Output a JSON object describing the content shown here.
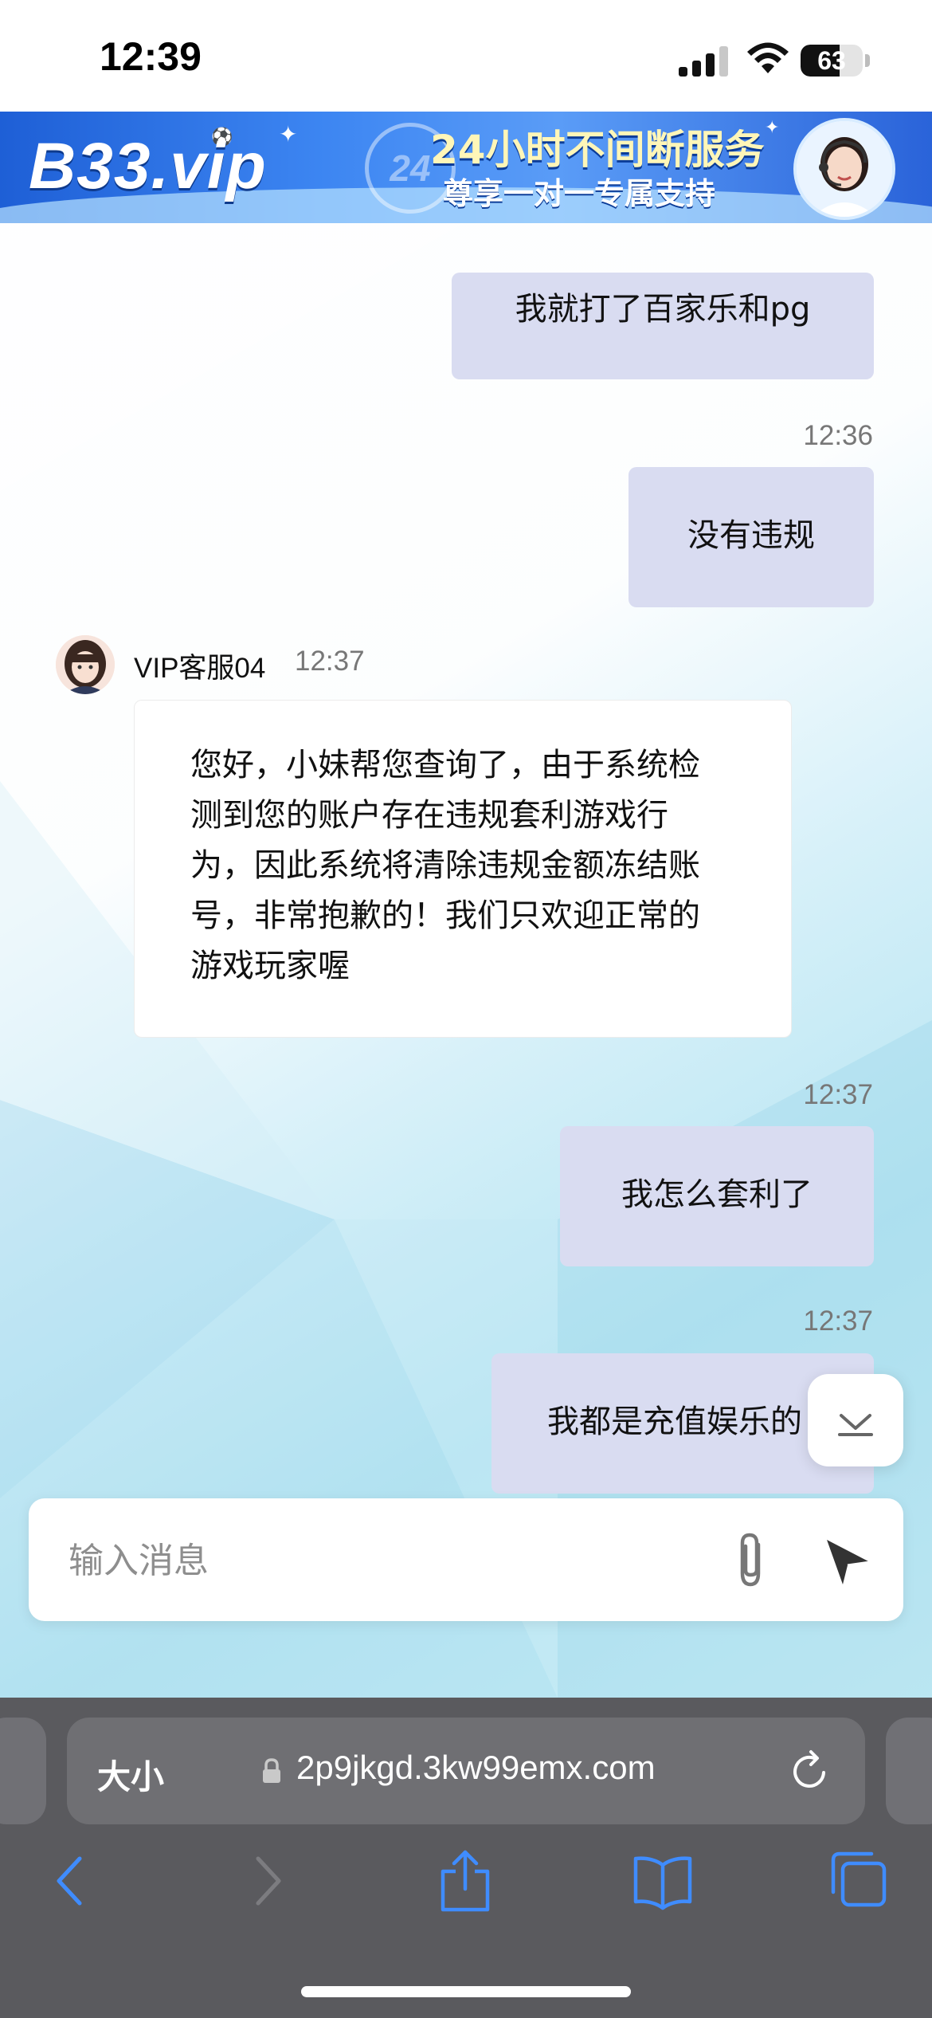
{
  "status_bar": {
    "time": "12:39",
    "battery_level": "63",
    "battery_fraction": 0.63
  },
  "banner": {
    "logo_text": "B33.vip",
    "hours_badge": "24",
    "headline": "24小时不间断服务",
    "subheadline": "尊享一对一专属支持"
  },
  "chat": {
    "messages": [
      {
        "from": "me",
        "text": "我就打了百家乐和pg"
      },
      {
        "from": "me",
        "time": "12:36",
        "text": "没有违规"
      },
      {
        "from": "agent",
        "name": "VIP客服04",
        "time": "12:37",
        "lines": [
          "您好，小妹帮您查询了，由于系统检",
          "测到您的账户存在违规套利游戏行",
          "为，因此系统将清除违规金额冻结账",
          "号，非常抱歉的！我们只欢迎正常的",
          "游戏玩家喔"
        ]
      },
      {
        "from": "me",
        "time": "12:37",
        "text": "我怎么套利了"
      },
      {
        "from": "me",
        "time": "12:37",
        "text": "我都是充值娱乐的"
      }
    ]
  },
  "composer": {
    "placeholder": "输入消息",
    "value": ""
  },
  "browser": {
    "text_size_label": "大小",
    "url": "2p9jkgd.3kw99emx.com"
  },
  "colors": {
    "my_bubble": "#d9dcf1",
    "agent_bubble": "#ffffff",
    "browser_chrome": "#5a5a5e",
    "toolbar_icon": "#3f8cff"
  },
  "icons": {
    "attach": "paperclip-icon",
    "send": "send-icon",
    "scroll": "scroll-down-icon",
    "lock": "lock-icon",
    "reload": "reload-icon",
    "back": "back-icon",
    "forward": "forward-icon",
    "share": "share-icon",
    "bookmarks": "bookmarks-icon",
    "tabs": "tabs-icon"
  }
}
